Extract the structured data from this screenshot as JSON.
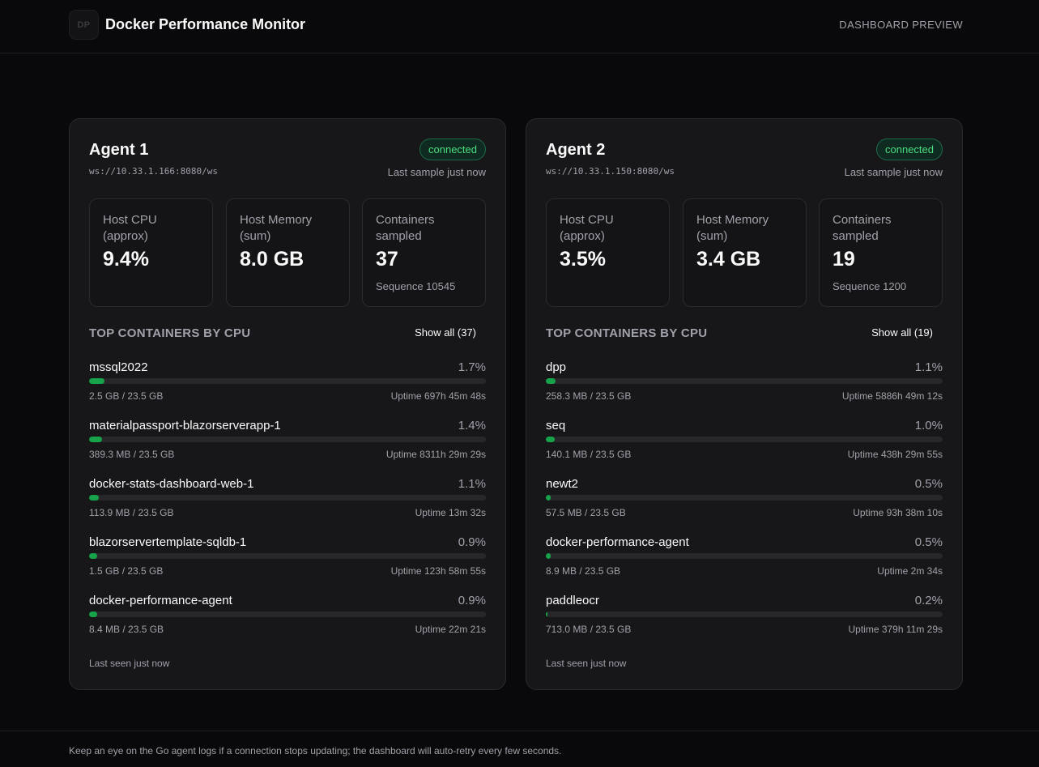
{
  "header": {
    "logo_text": "DP",
    "title": "Docker Performance Monitor",
    "preview_label": "DASHBOARD PREVIEW"
  },
  "agents": [
    {
      "name": "Agent 1",
      "url": "ws://10.33.1.166:8080/ws",
      "status": "connected",
      "last_sample": "Last sample just now",
      "stats": {
        "cpu_label": "Host CPU (approx)",
        "cpu_value": "9.4%",
        "mem_label": "Host Memory (sum)",
        "mem_value": "8.0 GB",
        "containers_label": "Containers sampled",
        "containers_value": "37",
        "sequence": "Sequence 10545"
      },
      "section_title": "TOP CONTAINERS BY CPU",
      "show_all": "Show all (37)",
      "containers": [
        {
          "name": "mssql2022",
          "cpu": "1.7%",
          "fill": 0.017,
          "mem": "2.5 GB / 23.5 GB",
          "uptime": "Uptime 697h 45m 48s"
        },
        {
          "name": "materialpassport-blazorserverapp-1",
          "cpu": "1.4%",
          "fill": 0.014,
          "mem": "389.3 MB / 23.5 GB",
          "uptime": "Uptime 8311h 29m 29s"
        },
        {
          "name": "docker-stats-dashboard-web-1",
          "cpu": "1.1%",
          "fill": 0.011,
          "mem": "113.9 MB / 23.5 GB",
          "uptime": "Uptime 13m 32s"
        },
        {
          "name": "blazorservertemplate-sqldb-1",
          "cpu": "0.9%",
          "fill": 0.009,
          "mem": "1.5 GB / 23.5 GB",
          "uptime": "Uptime 123h 58m 55s"
        },
        {
          "name": "docker-performance-agent",
          "cpu": "0.9%",
          "fill": 0.009,
          "mem": "8.4 MB / 23.5 GB",
          "uptime": "Uptime 22m 21s"
        }
      ],
      "last_seen": "Last seen just now"
    },
    {
      "name": "Agent 2",
      "url": "ws://10.33.1.150:8080/ws",
      "status": "connected",
      "last_sample": "Last sample just now",
      "stats": {
        "cpu_label": "Host CPU (approx)",
        "cpu_value": "3.5%",
        "mem_label": "Host Memory (sum)",
        "mem_value": "3.4 GB",
        "containers_label": "Containers sampled",
        "containers_value": "19",
        "sequence": "Sequence 1200"
      },
      "section_title": "TOP CONTAINERS BY CPU",
      "show_all": "Show all (19)",
      "containers": [
        {
          "name": "dpp",
          "cpu": "1.1%",
          "fill": 0.011,
          "mem": "258.3 MB / 23.5 GB",
          "uptime": "Uptime 5886h 49m 12s"
        },
        {
          "name": "seq",
          "cpu": "1.0%",
          "fill": 0.01,
          "mem": "140.1 MB / 23.5 GB",
          "uptime": "Uptime 438h 29m 55s"
        },
        {
          "name": "newt2",
          "cpu": "0.5%",
          "fill": 0.005,
          "mem": "57.5 MB / 23.5 GB",
          "uptime": "Uptime 93h 38m 10s"
        },
        {
          "name": "docker-performance-agent",
          "cpu": "0.5%",
          "fill": 0.005,
          "mem": "8.9 MB / 23.5 GB",
          "uptime": "Uptime 2m 34s"
        },
        {
          "name": "paddleocr",
          "cpu": "0.2%",
          "fill": 0.002,
          "mem": "713.0 MB / 23.5 GB",
          "uptime": "Uptime 379h 11m 29s"
        }
      ],
      "last_seen": "Last seen just now"
    }
  ],
  "footer": {
    "text": "Keep an eye on the Go agent logs if a connection stops updating; the dashboard will auto-retry every few seconds."
  },
  "colors": {
    "background": "#09090b",
    "card": "#17171a",
    "accent_green": "#16a34a",
    "badge_text": "#4ade80"
  }
}
